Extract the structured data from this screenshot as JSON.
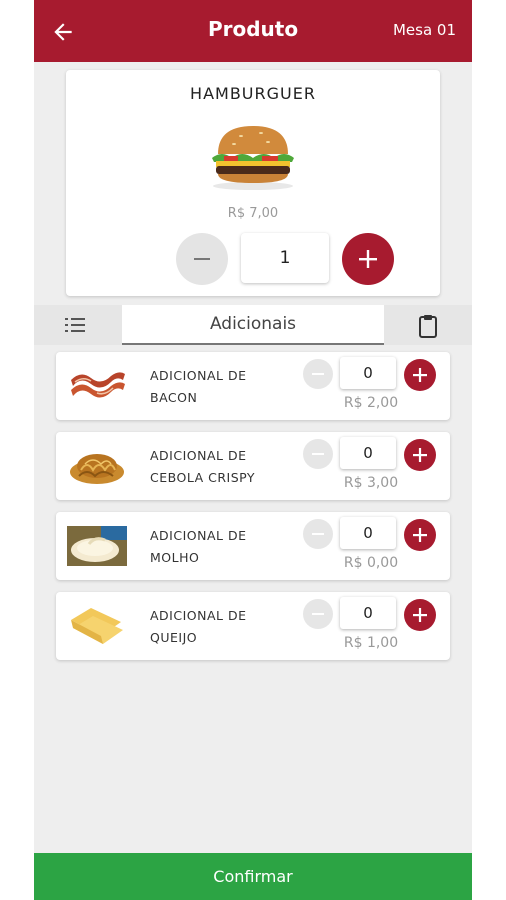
{
  "appbar": {
    "title": "Produto",
    "table": "Mesa 01",
    "back_icon": "arrow-left-icon"
  },
  "product": {
    "name": "HAMBURGUER",
    "price": "R$ 7,00",
    "quantity": "1"
  },
  "tabs": {
    "active_label": "Adicionais",
    "left_icon": "list-icon",
    "right_icon": "clipboard-icon"
  },
  "addons": [
    {
      "name_line1": "ADICIONAL DE",
      "name_line2": "BACON",
      "quantity": "0",
      "price": "R$ 2,00",
      "image": "bacon"
    },
    {
      "name_line1": "ADICIONAL DE",
      "name_line2": "CEBOLA CRISPY",
      "quantity": "0",
      "price": "R$ 3,00",
      "image": "crispy-onion"
    },
    {
      "name_line1": "ADICIONAL DE",
      "name_line2": "MOLHO",
      "quantity": "0",
      "price": "R$ 0,00",
      "image": "sauce"
    },
    {
      "name_line1": "ADICIONAL DE",
      "name_line2": "QUEIJO",
      "quantity": "0",
      "price": "R$ 1,00",
      "image": "cheese"
    }
  ],
  "confirm_label": "Confirmar",
  "colors": {
    "primary": "#a71b2f",
    "confirm": "#2ca444",
    "background": "#eeeeee"
  }
}
